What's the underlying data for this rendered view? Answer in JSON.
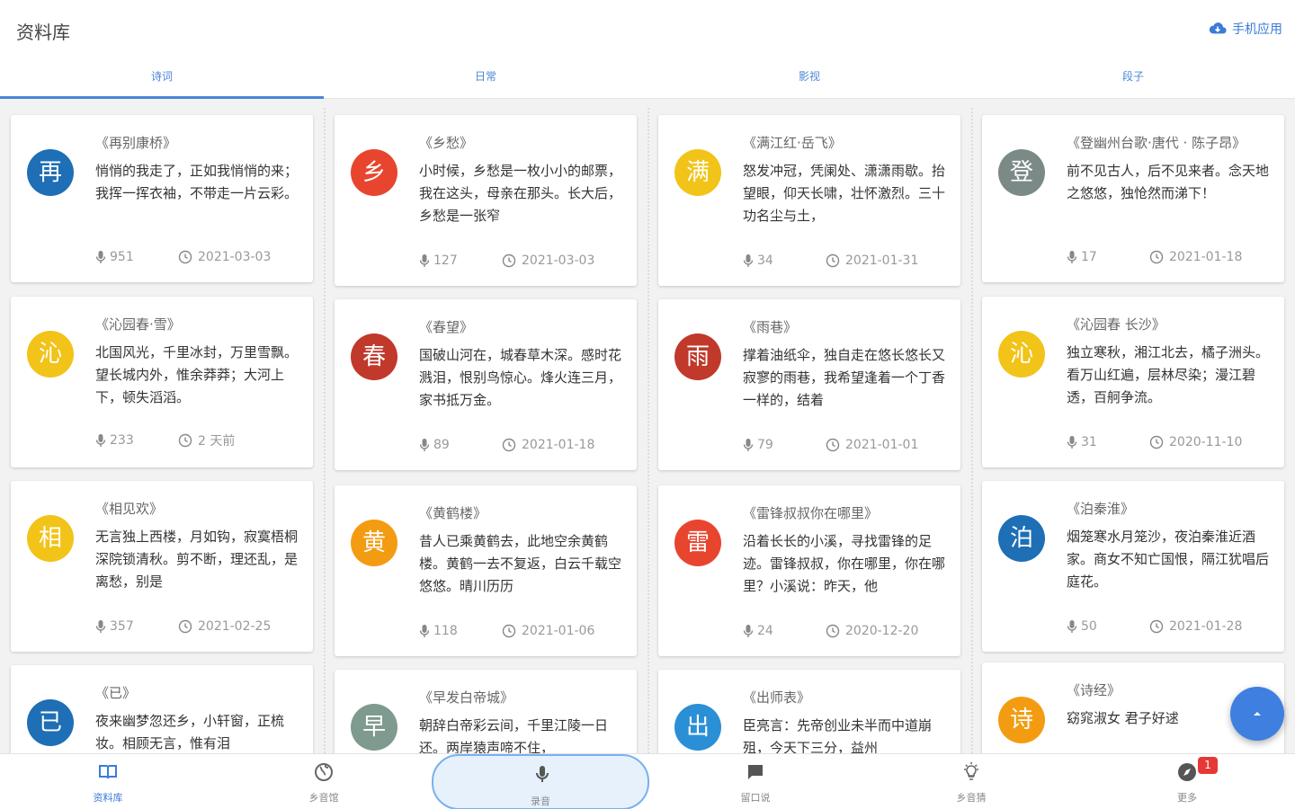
{
  "header": {
    "title": "资料库",
    "mobile_app": "手机应用"
  },
  "tabs": [
    "诗词",
    "日常",
    "影视",
    "段子"
  ],
  "columns": [
    [
      {
        "avatar": "再",
        "color": "#1e6fb5",
        "title": "《再别康桥》",
        "excerpt": "悄悄的我走了，正如我悄悄的来；我挥一挥衣袖，不带走一片云彩。",
        "plays": "951",
        "date": "2021-03-03"
      },
      {
        "avatar": "沁",
        "color": "#f2c318",
        "title": "《沁园春·雪》",
        "excerpt": "北国风光，千里冰封，万里雪飘。望长城内外，惟余莽莽；大河上下，顿失滔滔。",
        "plays": "233",
        "date": "2 天前"
      },
      {
        "avatar": "相",
        "color": "#f2c318",
        "title": "《相见欢》",
        "excerpt": "无言独上西楼，月如钩，寂寞梧桐深院锁清秋。剪不断，理还乱，是离愁，别是",
        "plays": "357",
        "date": "2021-02-25"
      },
      {
        "avatar": "已",
        "color": "#1e6fb5",
        "title": "《已》",
        "excerpt": "夜来幽梦忽还乡，小轩窗，正梳妆。相顾无言，惟有泪",
        "plays": "",
        "date": ""
      }
    ],
    [
      {
        "avatar": "乡",
        "color": "#e8452f",
        "title": "《乡愁》",
        "excerpt": "小时候，乡愁是一枚小小的邮票，我在这头，母亲在那头。长大后，乡愁是一张窄",
        "plays": "127",
        "date": "2021-03-03"
      },
      {
        "avatar": "春",
        "color": "#c0392b",
        "title": "《春望》",
        "excerpt": "国破山河在，城春草木深。感时花溅泪，恨别鸟惊心。烽火连三月，家书抵万金。",
        "plays": "89",
        "date": "2021-01-18"
      },
      {
        "avatar": "黄",
        "color": "#f39c12",
        "title": "《黄鹤楼》",
        "excerpt": "昔人已乘黄鹤去，此地空余黄鹤楼。黄鹤一去不复返，白云千载空悠悠。晴川历历",
        "plays": "118",
        "date": "2021-01-06"
      },
      {
        "avatar": "早",
        "color": "#7f9a8e",
        "title": "《早发白帝城》",
        "excerpt": "朝辞白帝彩云间，千里江陵一日还。两岸猿声啼不住，",
        "plays": "",
        "date": ""
      }
    ],
    [
      {
        "avatar": "满",
        "color": "#f2c318",
        "title": "《满江红·岳飞》",
        "excerpt": "怒发冲冠，凭阑处、潇潇雨歇。抬望眼，仰天长啸，壮怀激烈。三十功名尘与土，",
        "plays": "34",
        "date": "2021-01-31"
      },
      {
        "avatar": "雨",
        "color": "#c0392b",
        "title": "《雨巷》",
        "excerpt": "撑着油纸伞，独自走在悠长悠长又寂寥的雨巷，我希望逢着一个丁香一样的，结着",
        "plays": "79",
        "date": "2021-01-01"
      },
      {
        "avatar": "雷",
        "color": "#e8452f",
        "title": "《雷锋叔叔你在哪里》",
        "excerpt": "沿着长长的小溪，寻找雷锋的足迹。雷锋叔叔，你在哪里，你在哪里？小溪说：昨天，他",
        "plays": "24",
        "date": "2020-12-20"
      },
      {
        "avatar": "出",
        "color": "#2b8fd6",
        "title": "《出师表》",
        "excerpt": "臣亮言：先帝创业未半而中道崩殂，今天下三分，益州",
        "plays": "",
        "date": ""
      }
    ],
    [
      {
        "avatar": "登",
        "color": "#7b8a86",
        "title": "《登幽州台歌·唐代 · 陈子昂》",
        "excerpt": "前不见古人，后不见来者。念天地之悠悠，独怆然而涕下！",
        "plays": "17",
        "date": "2021-01-18"
      },
      {
        "avatar": "沁",
        "color": "#f2c318",
        "title": "《沁园春 长沙》",
        "excerpt": "独立寒秋，湘江北去，橘子洲头。看万山红遍，层林尽染；漫江碧透，百舸争流。",
        "plays": "31",
        "date": "2020-11-10"
      },
      {
        "avatar": "泊",
        "color": "#1e6fb5",
        "title": "《泊秦淮》",
        "excerpt": "烟笼寒水月笼沙，夜泊秦淮近酒家。商女不知亡国恨，隔江犹唱后庭花。",
        "plays": "50",
        "date": "2021-01-28"
      },
      {
        "avatar": "诗",
        "color": "#f39c12",
        "title": "《诗经》",
        "excerpt": "窈窕淑女 君子好逑",
        "plays": "",
        "date": ""
      }
    ]
  ],
  "bottom_nav": {
    "library": "资料库",
    "explore": "乡音馆",
    "record": "录音",
    "forum": "留口说",
    "ideas": "乡音猜",
    "more": "更多",
    "more_badge": "1"
  },
  "colors": {
    "accent": "#3b7bd8",
    "fab": "#3f7fe0"
  }
}
